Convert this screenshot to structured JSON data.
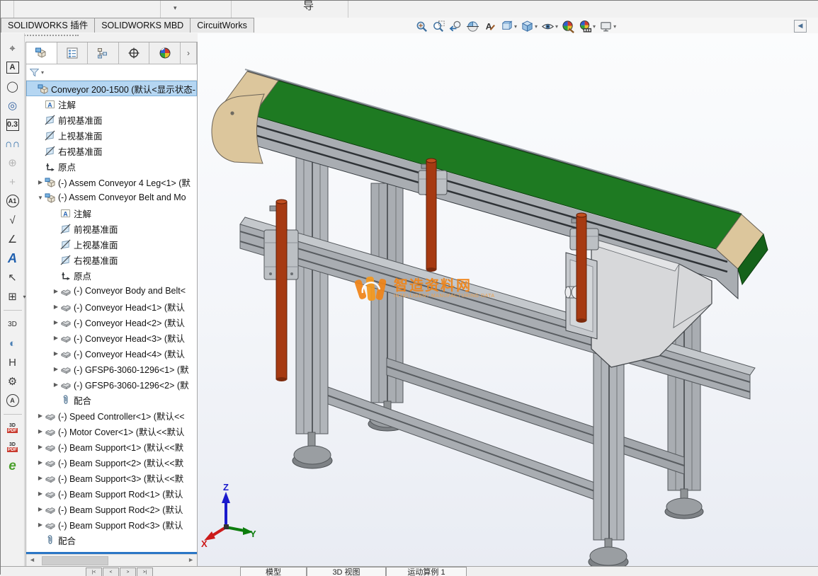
{
  "window": {
    "ribbon_overflow_hint": "导",
    "collapse_arrow": "◀"
  },
  "icons": {
    "caret": "▾",
    "expand": "▶",
    "collapse": "▼",
    "scroll_left": "◄",
    "scroll_right": "►",
    "panel_expand": "›"
  },
  "ribbon_tabs": [
    {
      "label": "SOLIDWORKS 插件"
    },
    {
      "label": "SOLIDWORKS MBD"
    },
    {
      "label": "CircuitWorks"
    }
  ],
  "headsup_toolbar": [
    {
      "name": "zoom-fit-icon",
      "caret": false
    },
    {
      "name": "zoom-area-icon",
      "caret": false
    },
    {
      "name": "previous-view-icon",
      "caret": false
    },
    {
      "name": "section-view-icon",
      "caret": false
    },
    {
      "name": "annotation-views-icon",
      "caret": false
    },
    {
      "name": "view-orientation-icon",
      "caret": true
    },
    {
      "name": "display-style-icon",
      "caret": true
    },
    {
      "name": "hide-show-items-icon",
      "caret": true
    },
    {
      "name": "edit-appearance-icon",
      "caret": false
    },
    {
      "name": "apply-scene-icon",
      "caret": true
    },
    {
      "name": "view-settings-icon",
      "caret": true
    }
  ],
  "left_toolbar": [
    {
      "name": "dimension-scheme-icon",
      "glyph": "⌖",
      "style": "plain",
      "color": "#3b3b3b"
    },
    {
      "name": "note-icon",
      "glyph": "A",
      "style": "boxed",
      "color": "#2f2f2f"
    },
    {
      "name": "balloon-icon",
      "glyph": "◯",
      "style": "plain",
      "color": "#3b3b3b"
    },
    {
      "name": "stacked-balloon-icon",
      "glyph": "◎",
      "style": "plain",
      "color": "#2f5f9e"
    },
    {
      "name": "geometric-tolerance-icon",
      "glyph": "0.3",
      "style": "boxed",
      "color": "#2f2f2f"
    },
    {
      "name": "auto-balloon-icon",
      "glyph": "∩∩",
      "style": "plain",
      "color": "#2f6da8"
    },
    {
      "name": "datum-target-icon",
      "glyph": "⊕",
      "style": "plain",
      "color": "#b5b5b5"
    },
    {
      "name": "show-annotations-icon",
      "glyph": "+",
      "style": "plain",
      "color": "#b5b5b5"
    },
    {
      "name": "datum-feature-icon",
      "glyph": "A1",
      "style": "circled",
      "color": "#2f2f2f"
    },
    {
      "name": "surface-finish-icon",
      "glyph": "√",
      "style": "plain",
      "color": "#3b3b3b"
    },
    {
      "name": "weld-symbol-icon",
      "glyph": "∠",
      "style": "plain",
      "color": "#3b3b3b"
    },
    {
      "name": "smart-note-icon",
      "glyph": "A",
      "style": "plain",
      "color": "#1f5fae"
    },
    {
      "name": "magnetic-line-icon",
      "glyph": "↖",
      "style": "plain",
      "color": "#3b3b3b"
    },
    {
      "name": "tables-icon",
      "glyph": "⊞",
      "style": "plain",
      "color": "#3b3b3b",
      "caret": true
    },
    {
      "name": "divider",
      "style": "divider"
    },
    {
      "name": "capture-3d-view-icon",
      "glyph": "3D",
      "style": "small",
      "color": "#2f2f2f"
    },
    {
      "name": "dynamic-section-icon",
      "glyph": "◐",
      "style": "plain",
      "color": "#4a7fb5"
    },
    {
      "name": "compare-icon",
      "glyph": "H",
      "style": "plain",
      "color": "#3b3b3b"
    },
    {
      "name": "smart-component-icon",
      "glyph": "⚙",
      "style": "plain",
      "color": "#3b3b3b"
    },
    {
      "name": "annotation-view-icon",
      "glyph": "A",
      "style": "circled",
      "color": "#3b3b3b"
    },
    {
      "name": "divider",
      "style": "divider"
    },
    {
      "name": "edit-3d-pdf-icon",
      "glyph": "PDF",
      "style": "twoline",
      "top": "3D"
    },
    {
      "name": "export-3d-pdf-icon",
      "glyph": "PDF",
      "style": "twoline",
      "top": "3D"
    },
    {
      "name": "edrawings-icon",
      "glyph": "e",
      "style": "plain",
      "color": "#4aa02c"
    }
  ],
  "tree": {
    "root": {
      "label": "Conveyor 200-1500 (默认<显示状态-",
      "icon": "assembly"
    },
    "items": [
      {
        "lvl": 1,
        "arrow": "",
        "icon": "folder-a",
        "label": "注解"
      },
      {
        "lvl": 1,
        "arrow": "",
        "icon": "plane",
        "label": "前视基准面"
      },
      {
        "lvl": 1,
        "arrow": "",
        "icon": "plane",
        "label": "上视基准面"
      },
      {
        "lvl": 1,
        "arrow": "",
        "icon": "plane",
        "label": "右视基准面"
      },
      {
        "lvl": 1,
        "arrow": "",
        "icon": "origin",
        "label": "原点"
      },
      {
        "lvl": 1,
        "arrow": "right",
        "icon": "assembly",
        "label": "(-) Assem Conveyor 4 Leg<1> (默"
      },
      {
        "lvl": 1,
        "arrow": "down",
        "icon": "assembly",
        "label": "(-) Assem Conveyor Belt and Mo"
      },
      {
        "lvl": 2,
        "arrow": "",
        "icon": "folder-a",
        "label": "注解"
      },
      {
        "lvl": 2,
        "arrow": "",
        "icon": "plane",
        "label": "前视基准面"
      },
      {
        "lvl": 2,
        "arrow": "",
        "icon": "plane",
        "label": "上视基准面"
      },
      {
        "lvl": 2,
        "arrow": "",
        "icon": "plane",
        "label": "右视基准面"
      },
      {
        "lvl": 2,
        "arrow": "",
        "icon": "origin",
        "label": "原点"
      },
      {
        "lvl": 2,
        "arrow": "right",
        "icon": "part",
        "label": "(-) Conveyor Body and Belt<"
      },
      {
        "lvl": 2,
        "arrow": "right",
        "icon": "part",
        "label": "(-) Conveyor Head<1> (默认"
      },
      {
        "lvl": 2,
        "arrow": "right",
        "icon": "part",
        "label": "(-) Conveyor Head<2> (默认"
      },
      {
        "lvl": 2,
        "arrow": "right",
        "icon": "part",
        "label": "(-) Conveyor Head<3> (默认"
      },
      {
        "lvl": 2,
        "arrow": "right",
        "icon": "part",
        "label": "(-) Conveyor Head<4> (默认"
      },
      {
        "lvl": 2,
        "arrow": "right",
        "icon": "part",
        "label": "(-) GFSP6-3060-1296<1> (默"
      },
      {
        "lvl": 2,
        "arrow": "right",
        "icon": "part",
        "label": "(-) GFSP6-3060-1296<2> (默"
      },
      {
        "lvl": 2,
        "arrow": "",
        "icon": "mates",
        "label": "配合"
      },
      {
        "lvl": 1,
        "arrow": "right",
        "icon": "part",
        "label": "(-) Speed Controller<1> (默认<<"
      },
      {
        "lvl": 1,
        "arrow": "right",
        "icon": "part",
        "label": "(-) Motor Cover<1> (默认<<默认"
      },
      {
        "lvl": 1,
        "arrow": "right",
        "icon": "part",
        "label": "(-) Beam Support<1> (默认<<默"
      },
      {
        "lvl": 1,
        "arrow": "right",
        "icon": "part",
        "label": "(-) Beam Support<2> (默认<<默"
      },
      {
        "lvl": 1,
        "arrow": "right",
        "icon": "part",
        "label": "(-) Beam Support<3> (默认<<默"
      },
      {
        "lvl": 1,
        "arrow": "right",
        "icon": "part",
        "label": "(-) Beam Support Rod<1> (默认"
      },
      {
        "lvl": 1,
        "arrow": "right",
        "icon": "part",
        "label": "(-) Beam Support Rod<2> (默认"
      },
      {
        "lvl": 1,
        "arrow": "right",
        "icon": "part",
        "label": "(-) Beam Support Rod<3> (默认"
      },
      {
        "lvl": 1,
        "arrow": "",
        "icon": "mates",
        "label": "配合"
      }
    ]
  },
  "viewport": {
    "watermark": {
      "title": "智造资料网",
      "subtitle": "INTELLIGENT MANUFACTURING DATA"
    },
    "triad": {
      "x": "X",
      "y": "Y",
      "z": "Z"
    }
  },
  "statusbar": {
    "nav": [
      "|<",
      "<",
      ">",
      ">|"
    ],
    "tabs": [
      "模型",
      "3D 视图",
      "运动算例 1"
    ]
  },
  "colors": {
    "accent_blue": "#2a76c6",
    "tree_highlight": "#b5d6f2",
    "belt_green": "#1e7a22",
    "frame_gray": "#a9adb2",
    "rod_red": "#a63a12",
    "roller_tan": "#dcc69c",
    "watermark_orange": "#f08519"
  }
}
